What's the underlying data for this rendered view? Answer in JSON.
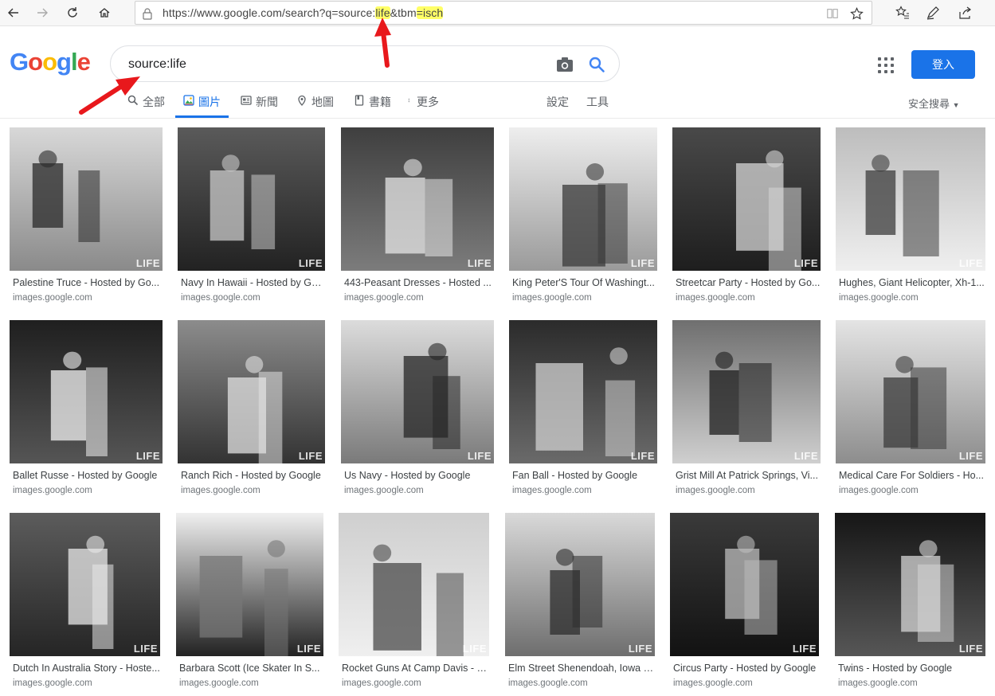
{
  "browser": {
    "url_prefix": "https://www.google.com/search?q=source:",
    "url_hl1": "life",
    "url_mid": "&tbm",
    "url_hl2": "=isch"
  },
  "logo": {
    "letters": [
      "G",
      "o",
      "o",
      "g",
      "l",
      "e"
    ],
    "colors": [
      "#4285f4",
      "#ea4335",
      "#fbbc05",
      "#4285f4",
      "#34a853",
      "#ea4335"
    ]
  },
  "search": {
    "value": "source:life"
  },
  "header": {
    "signin_label": "登入"
  },
  "tabs": {
    "all": "全部",
    "images": "圖片",
    "news": "新聞",
    "maps": "地圖",
    "books": "書籍",
    "more": "更多",
    "settings": "設定",
    "tools": "工具",
    "safe_search": "安全搜尋"
  },
  "watermark": "LIFE",
  "results": [
    {
      "title": "Palestine Truce - Hosted by Go...",
      "source": "images.google.com"
    },
    {
      "title": "Navy In Hawaii - Hosted by Go...",
      "source": "images.google.com"
    },
    {
      "title": "443-Peasant Dresses - Hosted ...",
      "source": "images.google.com"
    },
    {
      "title": "King Peter'S Tour Of Washingt...",
      "source": "images.google.com"
    },
    {
      "title": "Streetcar Party - Hosted by Go...",
      "source": "images.google.com"
    },
    {
      "title": "Hughes, Giant Helicopter, Xh-1...",
      "source": "images.google.com"
    },
    {
      "title": "Ballet Russe - Hosted by Google",
      "source": "images.google.com"
    },
    {
      "title": "Ranch Rich - Hosted by Google",
      "source": "images.google.com"
    },
    {
      "title": "Us Navy - Hosted by Google",
      "source": "images.google.com"
    },
    {
      "title": "Fan Ball - Hosted by Google",
      "source": "images.google.com"
    },
    {
      "title": "Grist Mill At Patrick Springs, Vi...",
      "source": "images.google.com"
    },
    {
      "title": "Medical Care For Soldiers - Ho...",
      "source": "images.google.com"
    },
    {
      "title": "Dutch In Australia Story - Hoste...",
      "source": "images.google.com"
    },
    {
      "title": "Barbara Scott (Ice Skater In S...",
      "source": "images.google.com"
    },
    {
      "title": "Rocket Guns At Camp Davis - H...",
      "source": "images.google.com"
    },
    {
      "title": "Elm Street Shenendoah, Iowa - ...",
      "source": "images.google.com"
    },
    {
      "title": "Circus Party - Hosted by Google",
      "source": "images.google.com"
    },
    {
      "title": "Twins - Hosted by Google",
      "source": "images.google.com"
    }
  ]
}
